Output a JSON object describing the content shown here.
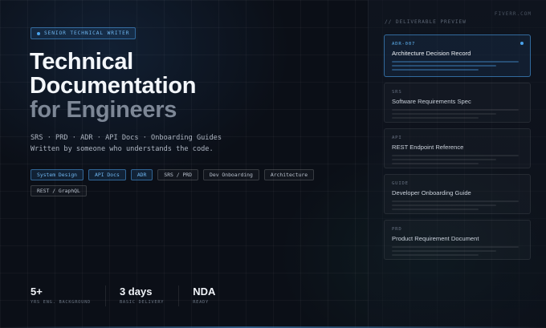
{
  "header": {
    "badge": "SENIOR TECHNICAL WRITER",
    "brand": "FIVERR.COM",
    "title_line1": "Technical",
    "title_line2": "Documentation",
    "title_line3": "for Engineers",
    "subtitle_line1": "SRS · PRD · ADR · API Docs · Onboarding Guides",
    "subtitle_line2": "Written by someone who understands the code."
  },
  "tags": [
    {
      "label": "System Design",
      "highlighted": true
    },
    {
      "label": "API Docs",
      "highlighted": true
    },
    {
      "label": "ADR",
      "highlighted": true
    },
    {
      "label": "SRS / PRD",
      "highlighted": false
    },
    {
      "label": "Dev Onboarding",
      "highlighted": false
    },
    {
      "label": "Architecture",
      "highlighted": false
    },
    {
      "label": "REST / GraphQL",
      "highlighted": false
    }
  ],
  "stats": [
    {
      "value": "5+",
      "label": "YRS ENG. BACKGROUND"
    },
    {
      "value": "3 days",
      "label": "BASIC DELIVERY"
    },
    {
      "value": "NDA",
      "label": "READY"
    }
  ],
  "preview": {
    "label": "// DELIVERABLE PREVIEW",
    "cards": [
      {
        "code": "ADR-007",
        "name": "Architecture Decision Record",
        "active": true
      },
      {
        "code": "SRS",
        "name": "Software Requirements Spec",
        "active": false
      },
      {
        "code": "API",
        "name": "REST Endpoint Reference",
        "active": false
      },
      {
        "code": "GUIDE",
        "name": "Developer Onboarding Guide",
        "active": false
      },
      {
        "code": "PRD",
        "name": "Product Requirement Document",
        "active": false
      }
    ]
  },
  "colors": {
    "background": "#0b0f17",
    "accent": "#4aa3ec",
    "accent_text": "#6fb6f0",
    "muted_title": "#7d8796"
  }
}
